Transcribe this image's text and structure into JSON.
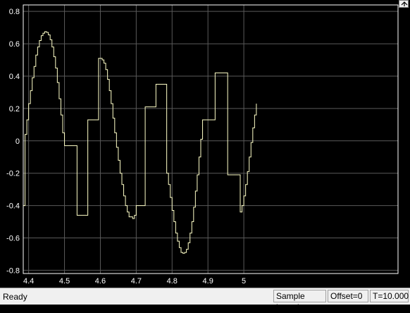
{
  "status": {
    "text": "Ready",
    "sample_mode": "Sample based",
    "offset": "Offset=0",
    "time": "T=10.000"
  },
  "toolbar": {
    "restore_icon": "restore-up-arrow-icon"
  },
  "colors": {
    "background": "#000000",
    "axes_border": "#ffffff",
    "grid": "#5a5a5a",
    "signal": "#ffffc8",
    "status_bar": "#f0f0f0"
  },
  "chart_data": {
    "type": "line",
    "title": "",
    "xlabel": "",
    "ylabel": "",
    "xlim": [
      4.385,
      5.43
    ],
    "ylim": [
      -0.82,
      0.84
    ],
    "grid": true,
    "step": true,
    "xticks": [
      4.4,
      4.5,
      4.6,
      4.7,
      4.8,
      4.9,
      5
    ],
    "xtick_labels": [
      "4.4",
      "4.5",
      "4.6",
      "4.7",
      "4.8",
      "4.9",
      "5"
    ],
    "yticks": [
      0.8,
      0.6,
      0.4,
      0.2,
      0,
      -0.2,
      -0.4,
      -0.6,
      -0.8
    ],
    "ytick_labels": [
      "0.8",
      "0.6",
      "0.4",
      "0.2",
      "0",
      "-0.2",
      "-0.4",
      "-0.6",
      "-0.8"
    ],
    "series": [
      {
        "color": "#ffffc8",
        "points": [
          [
            4.385,
            -0.4
          ],
          [
            4.39,
            -0.4
          ],
          [
            4.39,
            0.04
          ],
          [
            4.395,
            0.04
          ],
          [
            4.395,
            0.13
          ],
          [
            4.4,
            0.13
          ],
          [
            4.4,
            0.23
          ],
          [
            4.405,
            0.23
          ],
          [
            4.405,
            0.31
          ],
          [
            4.41,
            0.31
          ],
          [
            4.41,
            0.39
          ],
          [
            4.415,
            0.39
          ],
          [
            4.415,
            0.46
          ],
          [
            4.42,
            0.46
          ],
          [
            4.42,
            0.53
          ],
          [
            4.425,
            0.53
          ],
          [
            4.425,
            0.58
          ],
          [
            4.43,
            0.58
          ],
          [
            4.43,
            0.62
          ],
          [
            4.435,
            0.62
          ],
          [
            4.435,
            0.65
          ],
          [
            4.44,
            0.65
          ],
          [
            4.44,
            0.665
          ],
          [
            4.445,
            0.665
          ],
          [
            4.445,
            0.675
          ],
          [
            4.45,
            0.675
          ],
          [
            4.45,
            0.67
          ],
          [
            4.455,
            0.67
          ],
          [
            4.455,
            0.655
          ],
          [
            4.46,
            0.655
          ],
          [
            4.46,
            0.625
          ],
          [
            4.465,
            0.625
          ],
          [
            4.465,
            0.58
          ],
          [
            4.47,
            0.58
          ],
          [
            4.47,
            0.52
          ],
          [
            4.475,
            0.52
          ],
          [
            4.475,
            0.45
          ],
          [
            4.48,
            0.45
          ],
          [
            4.48,
            0.36
          ],
          [
            4.485,
            0.36
          ],
          [
            4.485,
            0.26
          ],
          [
            4.49,
            0.26
          ],
          [
            4.49,
            0.16
          ],
          [
            4.495,
            0.16
          ],
          [
            4.495,
            0.05
          ],
          [
            4.5,
            0.05
          ],
          [
            4.5,
            -0.03
          ],
          [
            4.535,
            -0.03
          ],
          [
            4.535,
            -0.46
          ],
          [
            4.565,
            -0.46
          ],
          [
            4.565,
            0.13
          ],
          [
            4.595,
            0.13
          ],
          [
            4.595,
            0.51
          ],
          [
            4.605,
            0.51
          ],
          [
            4.605,
            0.5
          ],
          [
            4.61,
            0.5
          ],
          [
            4.61,
            0.48
          ],
          [
            4.615,
            0.48
          ],
          [
            4.615,
            0.44
          ],
          [
            4.62,
            0.44
          ],
          [
            4.62,
            0.38
          ],
          [
            4.625,
            0.38
          ],
          [
            4.625,
            0.31
          ],
          [
            4.63,
            0.31
          ],
          [
            4.63,
            0.23
          ],
          [
            4.635,
            0.23
          ],
          [
            4.635,
            0.14
          ],
          [
            4.64,
            0.14
          ],
          [
            4.64,
            0.05
          ],
          [
            4.645,
            0.05
          ],
          [
            4.645,
            -0.04
          ],
          [
            4.65,
            -0.04
          ],
          [
            4.65,
            -0.12
          ],
          [
            4.655,
            -0.12
          ],
          [
            4.655,
            -0.2
          ],
          [
            4.66,
            -0.2
          ],
          [
            4.66,
            -0.27
          ],
          [
            4.665,
            -0.27
          ],
          [
            4.665,
            -0.34
          ],
          [
            4.67,
            -0.34
          ],
          [
            4.67,
            -0.4
          ],
          [
            4.675,
            -0.4
          ],
          [
            4.675,
            -0.44
          ],
          [
            4.68,
            -0.44
          ],
          [
            4.68,
            -0.47
          ],
          [
            4.69,
            -0.47
          ],
          [
            4.69,
            -0.48
          ],
          [
            4.695,
            -0.48
          ],
          [
            4.695,
            -0.46
          ],
          [
            4.7,
            -0.46
          ],
          [
            4.7,
            -0.4
          ],
          [
            4.725,
            -0.4
          ],
          [
            4.725,
            0.21
          ],
          [
            4.755,
            0.21
          ],
          [
            4.755,
            0.35
          ],
          [
            4.785,
            0.35
          ],
          [
            4.785,
            -0.2
          ],
          [
            4.79,
            -0.2
          ],
          [
            4.79,
            -0.27
          ],
          [
            4.795,
            -0.27
          ],
          [
            4.795,
            -0.35
          ],
          [
            4.8,
            -0.35
          ],
          [
            4.8,
            -0.43
          ],
          [
            4.805,
            -0.43
          ],
          [
            4.805,
            -0.5
          ],
          [
            4.81,
            -0.5
          ],
          [
            4.81,
            -0.57
          ],
          [
            4.815,
            -0.57
          ],
          [
            4.815,
            -0.62
          ],
          [
            4.82,
            -0.62
          ],
          [
            4.82,
            -0.66
          ],
          [
            4.825,
            -0.66
          ],
          [
            4.825,
            -0.69
          ],
          [
            4.83,
            -0.69
          ],
          [
            4.83,
            -0.695
          ],
          [
            4.835,
            -0.695
          ],
          [
            4.835,
            -0.69
          ],
          [
            4.84,
            -0.69
          ],
          [
            4.84,
            -0.67
          ],
          [
            4.845,
            -0.67
          ],
          [
            4.845,
            -0.63
          ],
          [
            4.85,
            -0.63
          ],
          [
            4.85,
            -0.57
          ],
          [
            4.855,
            -0.57
          ],
          [
            4.855,
            -0.5
          ],
          [
            4.86,
            -0.5
          ],
          [
            4.86,
            -0.41
          ],
          [
            4.865,
            -0.41
          ],
          [
            4.865,
            -0.31
          ],
          [
            4.87,
            -0.31
          ],
          [
            4.87,
            -0.21
          ],
          [
            4.875,
            -0.21
          ],
          [
            4.875,
            -0.1
          ],
          [
            4.88,
            -0.1
          ],
          [
            4.88,
            0.01
          ],
          [
            4.885,
            0.01
          ],
          [
            4.885,
            0.13
          ],
          [
            4.92,
            0.13
          ],
          [
            4.92,
            0.42
          ],
          [
            4.955,
            0.42
          ],
          [
            4.955,
            -0.21
          ],
          [
            4.99,
            -0.21
          ],
          [
            4.99,
            -0.44
          ],
          [
            4.995,
            -0.44
          ],
          [
            4.995,
            -0.4
          ],
          [
            5.0,
            -0.4
          ],
          [
            5.0,
            -0.34
          ],
          [
            5.005,
            -0.34
          ],
          [
            5.005,
            -0.27
          ],
          [
            5.01,
            -0.27
          ],
          [
            5.01,
            -0.19
          ],
          [
            5.015,
            -0.19
          ],
          [
            5.015,
            -0.1
          ],
          [
            5.02,
            -0.1
          ],
          [
            5.02,
            -0.01
          ],
          [
            5.025,
            -0.01
          ],
          [
            5.025,
            0.08
          ],
          [
            5.03,
            0.08
          ],
          [
            5.03,
            0.16
          ],
          [
            5.035,
            0.16
          ],
          [
            5.035,
            0.23
          ]
        ]
      }
    ]
  }
}
